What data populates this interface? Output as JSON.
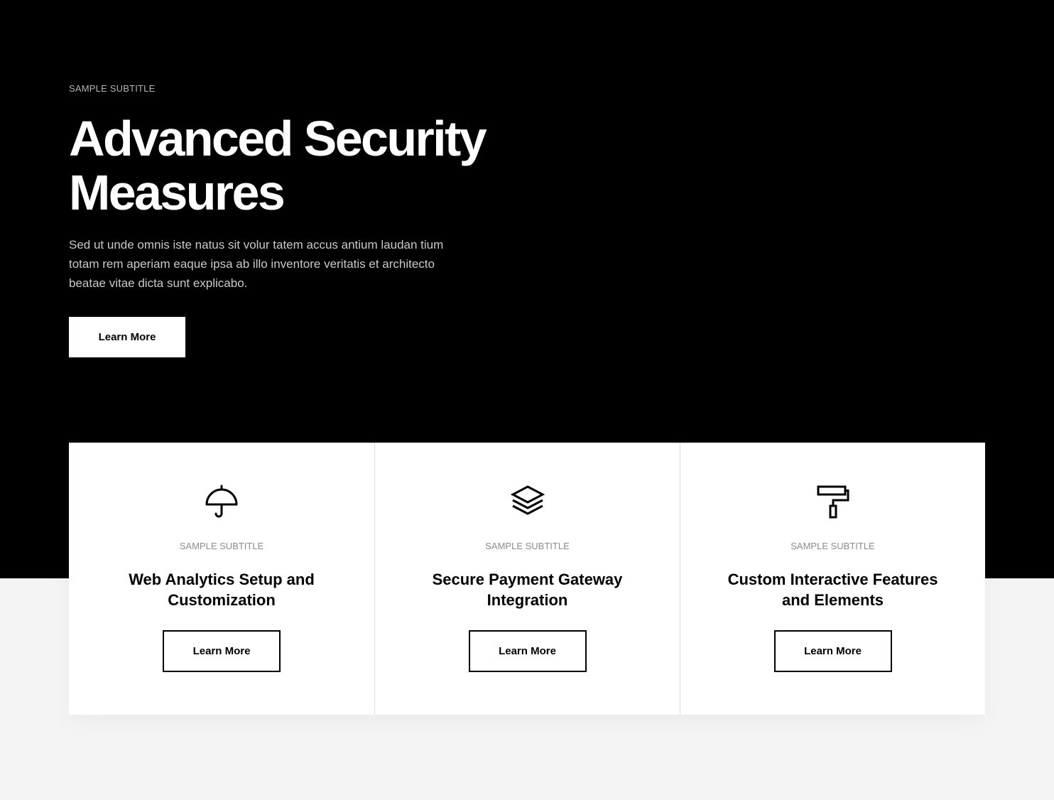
{
  "hero": {
    "subtitle": "SAMPLE SUBTITLE",
    "title": "Advanced Security Measures",
    "description": "Sed ut unde omnis iste natus sit volur tatem accus antium laudan tium totam rem aperiam eaque ipsa ab illo inventore veritatis et architecto beatae vitae dicta sunt explicabo.",
    "button_label": "Learn More"
  },
  "cards": [
    {
      "icon": "umbrella-icon",
      "subtitle": "SAMPLE SUBTITLE",
      "title": "Web Analytics Setup and Customization",
      "button_label": "Learn More"
    },
    {
      "icon": "layers-icon",
      "subtitle": "SAMPLE SUBTITLE",
      "title": "Secure Payment Gateway Integration",
      "button_label": "Learn More"
    },
    {
      "icon": "paint-roller-icon",
      "subtitle": "SAMPLE SUBTITLE",
      "title": "Custom Interactive Features and Elements",
      "button_label": "Learn More"
    }
  ],
  "colors": {
    "hero_background": "#000000",
    "page_background": "#f4f4f4",
    "card_background": "#ffffff",
    "text_primary": "#000000",
    "text_muted": "#8c8c8c"
  }
}
